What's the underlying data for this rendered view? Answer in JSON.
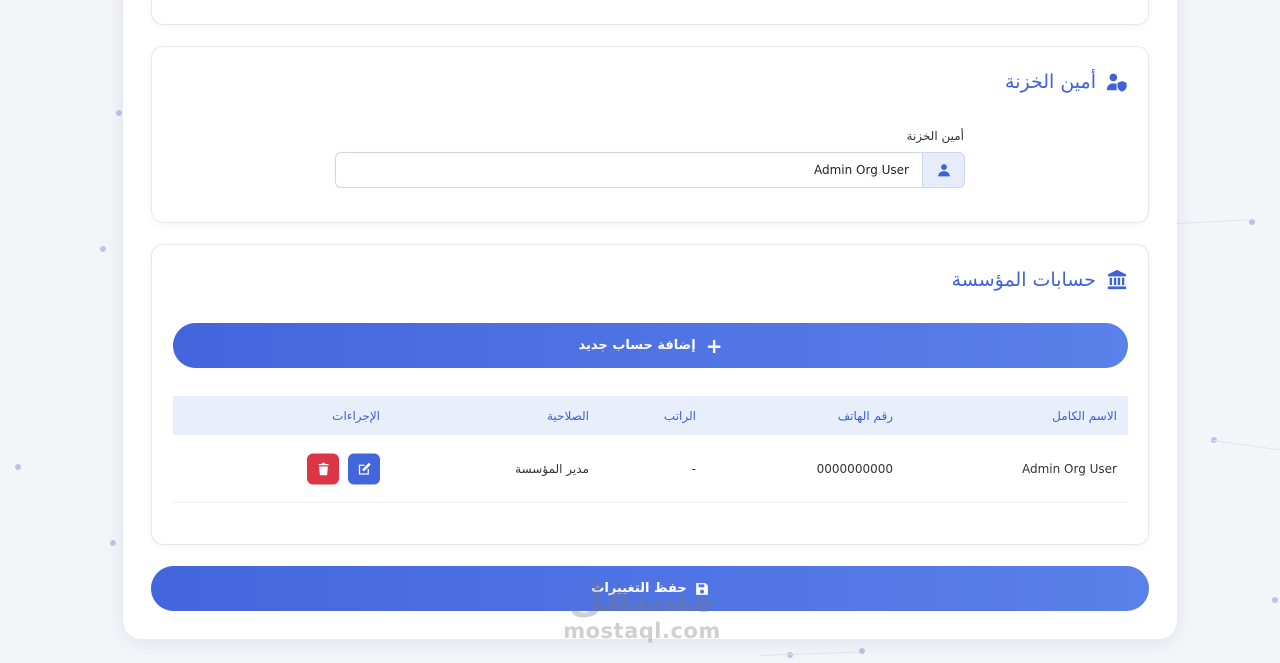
{
  "treasurer_section": {
    "title": "أمين الخزنة",
    "field_label": "أمين الخزنة",
    "field_value": "Admin Org User"
  },
  "accounts_section": {
    "title": "حسابات المؤسسة",
    "add_button_label": "إضافة حساب جديد",
    "columns": [
      "الاسم الكامل",
      "رقم الهاتف",
      "الراتب",
      "الصلاحية",
      "الإجراءات"
    ],
    "rows": [
      {
        "full_name": "Admin Org User",
        "phone": "0000000000",
        "salary": "-",
        "role": "مدير المؤسسة"
      }
    ]
  },
  "save_button_label": "حفظ التغييرات",
  "watermark": {
    "logo": "مستقل",
    "url": "mostaql.com"
  },
  "icons": {
    "treasurer": "user-shield-icon",
    "accounts": "bank-icon",
    "field_addon": "user-icon",
    "add": "plus-icon",
    "edit": "edit-icon",
    "delete": "trash-icon",
    "save": "save-icon"
  },
  "colors": {
    "accent": "#4466dd",
    "danger": "#dc3545",
    "header_bg": "#e9eefb"
  }
}
